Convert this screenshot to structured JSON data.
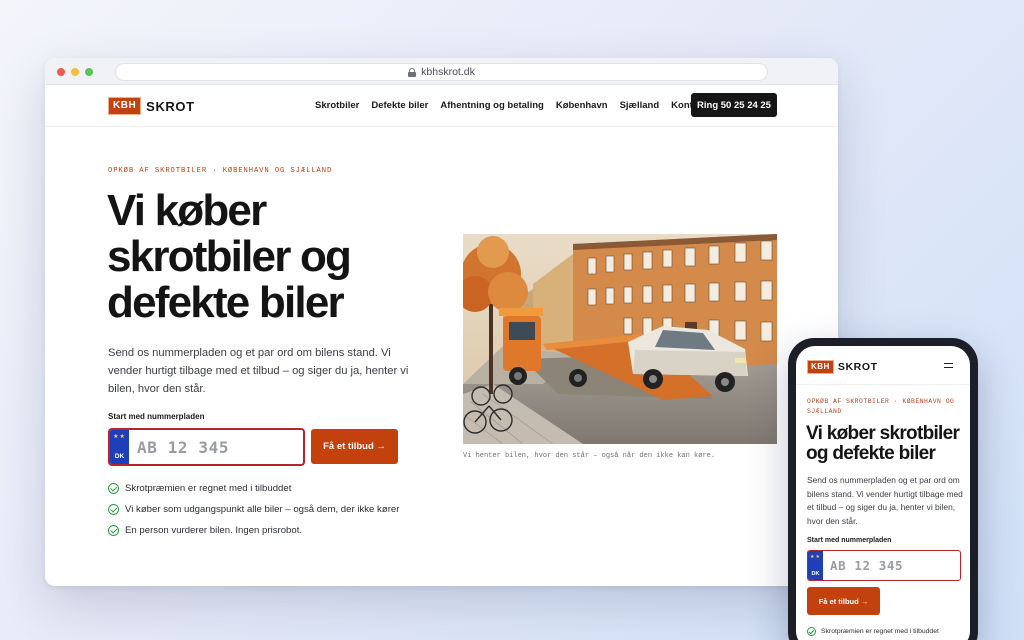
{
  "browser": {
    "url": "kbhskrot.dk"
  },
  "brand": {
    "badge": "KBH",
    "name": "SKROT",
    "accent": "#c2410c"
  },
  "nav": {
    "items": [
      "Skrotbiler",
      "Defekte biler",
      "Afhentning og betaling",
      "København",
      "Sjælland",
      "Kontakt"
    ],
    "call_label": "Ring 50 25 24 25"
  },
  "hero": {
    "eyebrow": "OPKØB AF SKROTBILER · KØBENHAVN OG SJÆLLAND",
    "title": "Vi køber skrotbiler og defekte biler",
    "lead": "Send os nummerpladen og et par ord om bilens stand. Vi vender hurtigt tilbage med et tilbud – og siger du ja, henter vi bilen, hvor den står.",
    "plate_label": "Start med nummerpladen",
    "plate_placeholder": "AB 12 345",
    "plate_country": "DK",
    "plate_stars": "★★",
    "cta_label": "Få et tilbud →",
    "benefits": [
      "Skrotpræmien er regnet med i tilbuddet",
      "Vi køber som udgangspunkt alle biler – også dem, der ikke kører",
      "En person vurderer bilen. Ingen prisrobot."
    ],
    "photo_caption": "Vi henter bilen, hvor den står – også når den ikke kan køre."
  },
  "icons": {
    "lock": "lock-icon",
    "check": "check-icon",
    "menu": "menu-icon"
  }
}
